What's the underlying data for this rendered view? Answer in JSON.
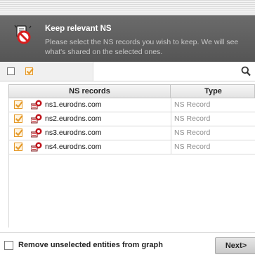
{
  "header": {
    "title": "Keep relevant NS",
    "description": "Please select the NS records you wish to keep. We will see\nwhat's shared on the selected ones.",
    "icon": "no-entity-icon"
  },
  "filter": {
    "select_none_checked": false,
    "select_all_checked": true,
    "search_value": "",
    "search_icon": "search-icon"
  },
  "table": {
    "columns": [
      "NS records",
      "Type"
    ],
    "rows": [
      {
        "name": "ns1.eurodns.com",
        "type": "NS Record",
        "checked": true
      },
      {
        "name": "ns2.eurodns.com",
        "type": "NS Record",
        "checked": true
      },
      {
        "name": "ns3.eurodns.com",
        "type": "NS Record",
        "checked": true
      },
      {
        "name": "ns4.eurodns.com",
        "type": "NS Record",
        "checked": true
      }
    ]
  },
  "footer": {
    "remove_label": "Remove unselected entities from graph",
    "remove_checked": false,
    "next_label": "Next>"
  },
  "colors": {
    "header_bg": "#5f5f5f",
    "check_accent": "#e59a2b",
    "ns_icon_red": "#c0141b"
  }
}
